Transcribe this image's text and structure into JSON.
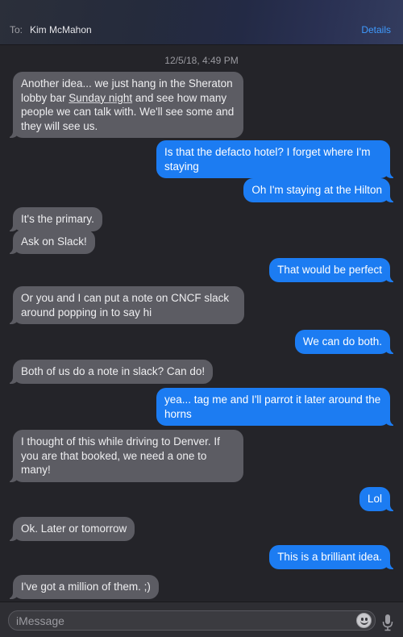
{
  "header": {
    "to_label": "To:",
    "recipient": "Kim McMahon",
    "details_label": "Details"
  },
  "thread": {
    "timestamp": "12/5/18, 4:49 PM",
    "messages": [
      {
        "from": "them",
        "text_pre": "Another idea...  we just hang in the Sheraton lobby bar ",
        "text_link": "Sunday night",
        "text_post": " and see how many people we can talk with. We'll see some and they will see us."
      },
      {
        "from": "me",
        "text": "Is that the defacto hotel? I forget where I'm staying"
      },
      {
        "from": "me",
        "text": "Oh I'm staying at the Hilton"
      },
      {
        "from": "them",
        "text": "It's the primary."
      },
      {
        "from": "them",
        "text": "Ask on Slack!"
      },
      {
        "from": "me",
        "text": "That would be perfect"
      },
      {
        "from": "them",
        "text": "Or you and I can put a note on CNCF slack around popping in to say hi"
      },
      {
        "from": "me",
        "text": "We can do both."
      },
      {
        "from": "them",
        "text": "Both of us do a note in slack? Can do!"
      },
      {
        "from": "me",
        "text": "yea... tag me and I'll parrot it later around the horns"
      },
      {
        "from": "them",
        "text": "I thought of this while driving to Denver. If you are that booked, we need a one to many!"
      },
      {
        "from": "me",
        "text": "Lol"
      },
      {
        "from": "them",
        "text": "Ok. Later or tomorrow"
      },
      {
        "from": "me",
        "text": "This is a brilliant idea."
      },
      {
        "from": "them",
        "text": "I've got a million of them. ;)"
      }
    ]
  },
  "composer": {
    "placeholder": "iMessage",
    "emoji_icon": "emoji-icon",
    "mic_icon": "microphone-icon"
  },
  "colors": {
    "incoming_bubble": "#5c5c63",
    "outgoing_bubble": "#1c7cf2",
    "accent": "#3f9bff"
  }
}
